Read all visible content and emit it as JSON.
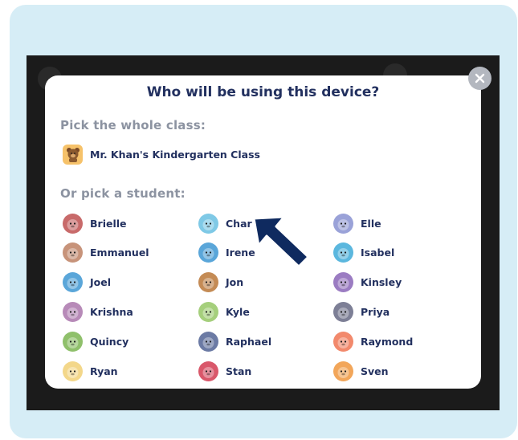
{
  "modal": {
    "title": "Who will be using this device?",
    "class_heading": "Pick the whole class:",
    "class_name": "Mr. Khan's Kindergarten Class",
    "class_icon": "bear-icon",
    "class_icon_color": "#f6c26a",
    "student_heading": "Or pick a student:",
    "close_icon": "close-icon"
  },
  "students": [
    {
      "name": "Brielle",
      "icon": "gorilla-avatar-icon",
      "color": "#c86a6a"
    },
    {
      "name": "Char",
      "icon": "polar-bear-avatar-icon",
      "color": "#7fc9e6"
    },
    {
      "name": "Elle",
      "icon": "lion-avatar-icon",
      "color": "#9aa2d8"
    },
    {
      "name": "Emmanuel",
      "icon": "snake-avatar-icon",
      "color": "#c7937a"
    },
    {
      "name": "Irene",
      "icon": "tiger-avatar-icon",
      "color": "#5aa6d9"
    },
    {
      "name": "Isabel",
      "icon": "otter-avatar-icon",
      "color": "#5bb7de"
    },
    {
      "name": "Joel",
      "icon": "bee-avatar-icon",
      "color": "#5aa6d9"
    },
    {
      "name": "Jon",
      "icon": "turtle-avatar-icon",
      "color": "#c48b55"
    },
    {
      "name": "Kinsley",
      "icon": "yeti-avatar-icon",
      "color": "#9b7cc2"
    },
    {
      "name": "Krishna",
      "icon": "creature-avatar-icon",
      "color": "#b78ab8"
    },
    {
      "name": "Kyle",
      "icon": "squirrel-avatar-icon",
      "color": "#a5cf7c"
    },
    {
      "name": "Priya",
      "icon": "giraffe-avatar-icon",
      "color": "#7d7f96"
    },
    {
      "name": "Quincy",
      "icon": "rooster-avatar-icon",
      "color": "#8fc06b"
    },
    {
      "name": "Raphael",
      "icon": "unicorn-avatar-icon",
      "color": "#6b7aa4"
    },
    {
      "name": "Raymond",
      "icon": "monkey-avatar-icon",
      "color": "#f2896c"
    },
    {
      "name": "Ryan",
      "icon": "hippo-avatar-icon",
      "color": "#f3d78a"
    },
    {
      "name": "Stan",
      "icon": "goat-avatar-icon",
      "color": "#d9576a"
    },
    {
      "name": "Sven",
      "icon": "hedgehog-avatar-icon",
      "color": "#f2a65a"
    }
  ],
  "pointer": {
    "icon": "arrow-pointer-icon",
    "color": "#0f2a5f",
    "target": "Char"
  }
}
